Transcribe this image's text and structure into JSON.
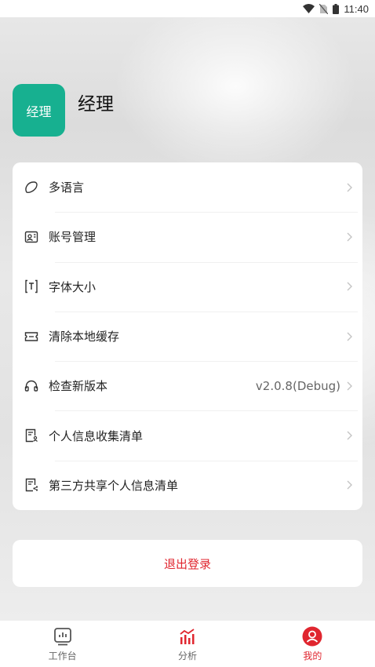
{
  "status_bar": {
    "time": "11:40"
  },
  "profile": {
    "avatar_text": "经理",
    "name": "经理"
  },
  "menu": {
    "items": [
      {
        "label": "多语言",
        "icon": "language-icon"
      },
      {
        "label": "账号管理",
        "icon": "account-card-icon"
      },
      {
        "label": "字体大小",
        "icon": "font-size-icon"
      },
      {
        "label": "清除本地缓存",
        "icon": "ticket-icon"
      },
      {
        "label": "检查新版本",
        "icon": "headset-icon",
        "value": "v2.0.8(Debug)"
      },
      {
        "label": "个人信息收集清单",
        "icon": "doc-person-icon"
      },
      {
        "label": "第三方共享个人信息清单",
        "icon": "doc-share-icon"
      }
    ]
  },
  "logout": {
    "label": "退出登录"
  },
  "tabbar": {
    "tabs": [
      {
        "label": "工作台",
        "icon": "dashboard-icon"
      },
      {
        "label": "分析",
        "icon": "chart-icon"
      },
      {
        "label": "我的",
        "icon": "user-icon"
      }
    ]
  },
  "colors": {
    "accent": "#e0262f",
    "avatar_bg": "#17b090"
  }
}
